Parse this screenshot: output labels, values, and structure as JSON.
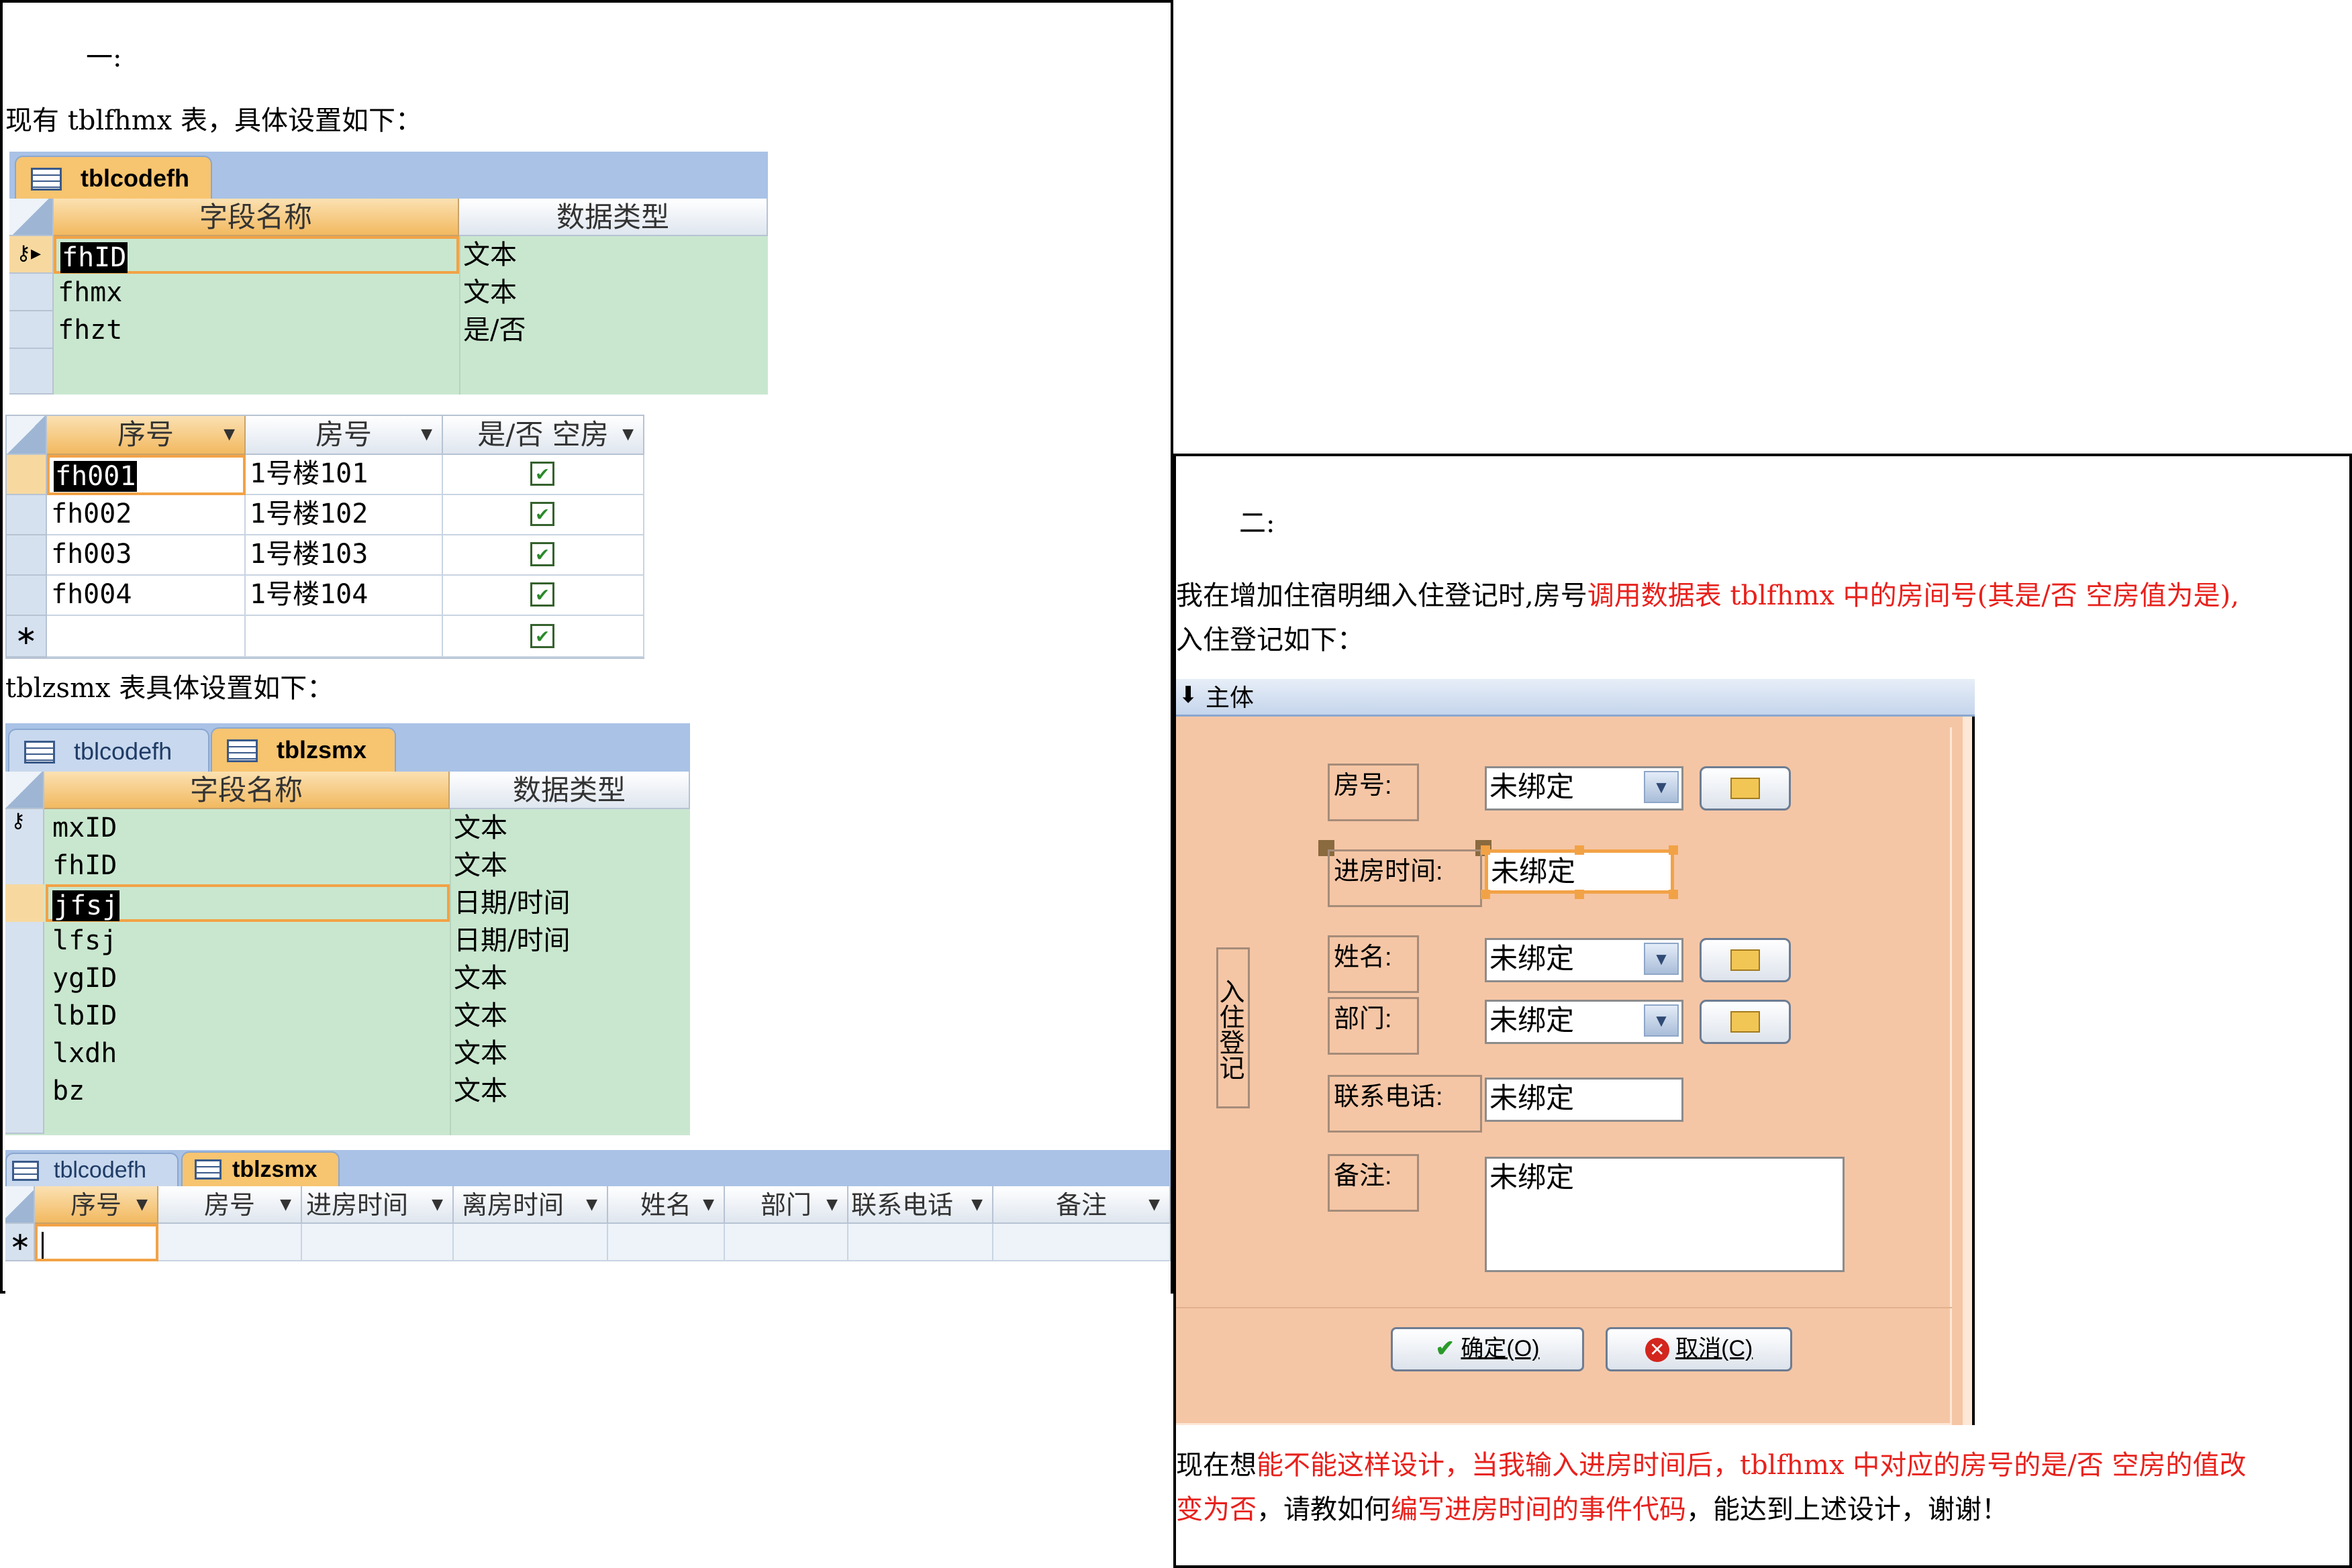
{
  "left": {
    "heading": "一:",
    "intro": "现有 tblfhmx 表，具体设置如下：",
    "design1": {
      "tab": "tblcodefh",
      "col_name": "字段名称",
      "col_type": "数据类型",
      "rows": [
        {
          "name": "fhID",
          "type": "文本"
        },
        {
          "name": "fhmx",
          "type": "文本"
        },
        {
          "name": "fhzt",
          "type": "是/否"
        }
      ]
    },
    "datasheet1": {
      "headers": [
        "序号",
        "房号",
        "是/否  空房"
      ],
      "rows": [
        {
          "id": "fh001",
          "room": "1号楼101",
          "checked": "✔"
        },
        {
          "id": "fh002",
          "room": "1号楼102",
          "checked": "✔"
        },
        {
          "id": "fh003",
          "room": "1号楼103",
          "checked": "✔"
        },
        {
          "id": "fh004",
          "room": "1号楼104",
          "checked": "✔"
        }
      ],
      "new_row_marker": "∗",
      "new_row_check": "✔"
    },
    "intro2": "tblzsmx 表具体设置如下：",
    "design2": {
      "tab_inactive": "tblcodefh",
      "tab_active": "tblzsmx",
      "col_name": "字段名称",
      "col_type": "数据类型",
      "rows": [
        {
          "name": "mxID",
          "type": "文本"
        },
        {
          "name": "fhID",
          "type": "文本"
        },
        {
          "name": "jfsj",
          "type": "日期/时间"
        },
        {
          "name": "lfsj",
          "type": "日期/时间"
        },
        {
          "name": "ygID",
          "type": "文本"
        },
        {
          "name": "lbID",
          "type": "文本"
        },
        {
          "name": "lxdh",
          "type": "文本"
        },
        {
          "name": "bz",
          "type": "文本"
        }
      ]
    },
    "datasheet2": {
      "tab_inactive": "tblcodefh",
      "tab_active": "tblzsmx",
      "headers": [
        "序号",
        "房号",
        "进房时间",
        "离房时间",
        "姓名",
        "部门",
        "联系电话",
        "备注"
      ],
      "new_row_marker": "∗"
    }
  },
  "right": {
    "heading": "二:",
    "para1_a": "我在增加住宿明细入住登记时,房号",
    "para1_b": "调用数据表 tblfhmx 中的房间号(其是/否  空房值为是),",
    "para1_c": "入住登记如下：",
    "section": "主体",
    "form_title": "入住登记",
    "fields": {
      "room": {
        "label": "房号:",
        "value": "未绑定"
      },
      "checkin": {
        "label": "进房时间:",
        "value": "未绑定"
      },
      "name": {
        "label": "姓名:",
        "value": "未绑定"
      },
      "dept": {
        "label": "部门:",
        "value": "未绑定"
      },
      "phone": {
        "label": "联系电话:",
        "value": "未绑定"
      },
      "note": {
        "label": "备注:",
        "value": "未绑定"
      }
    },
    "ok_label": "确定(O)",
    "cancel_label": "取消(C)",
    "q_a": "现在想",
    "q_b": "能不能这样设计，当我输入进房时间后，tblfhmx 中对应的房号的是/否  空房的值改",
    "q_c": "变为否",
    "q_d": "，请教如何",
    "q_e": "编写进房时间的事件代码",
    "q_f": "，能达到上述设计，谢谢！"
  },
  "colors": {
    "form_bg": "#f5c6a5",
    "grid_green": "#c9e7cf",
    "header_orange": "#f2b960",
    "tab_blue": "#a9c2e6",
    "highlight_red": "#e8211c"
  }
}
